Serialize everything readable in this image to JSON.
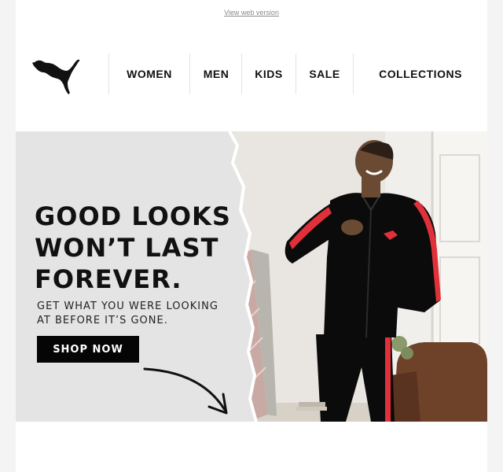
{
  "header": {
    "web_version_link": "View web version"
  },
  "brand": {
    "logo": "puma-cat-logo"
  },
  "nav": {
    "items": [
      {
        "label": "WOMEN"
      },
      {
        "label": "MEN"
      },
      {
        "label": "KIDS"
      },
      {
        "label": "SALE"
      },
      {
        "label": "COLLECTIONS"
      }
    ]
  },
  "hero": {
    "headline": [
      "GOOD LOOKS",
      "WON’T LAST",
      "FOREVER."
    ],
    "subline": [
      "GET WHAT YOU WERE LOOKING",
      "AT BEFORE IT’S GONE."
    ],
    "cta_label": "SHOP NOW",
    "arrow_icon": "curved-arrow-icon",
    "colors": {
      "accent": "#e0303a",
      "dark": "#0b0b0b",
      "paper": "#e4e4e4"
    }
  }
}
